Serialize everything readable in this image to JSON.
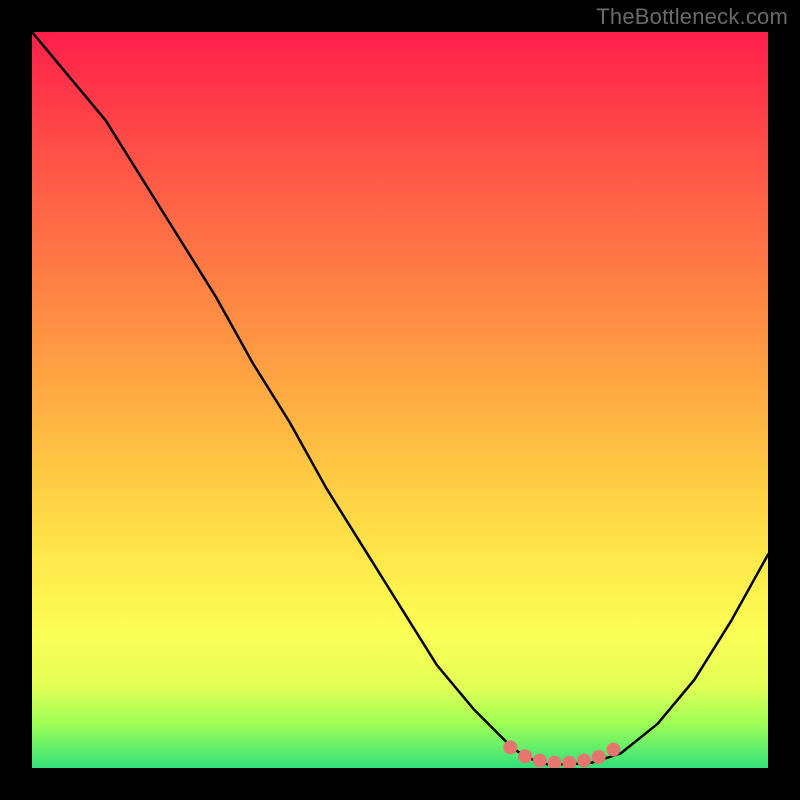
{
  "watermark": "TheBottleneck.com",
  "chart_data": {
    "type": "line",
    "title": "",
    "xlabel": "",
    "ylabel": "",
    "xlim": [
      0,
      100
    ],
    "ylim": [
      0,
      100
    ],
    "series": [
      {
        "name": "curve",
        "x": [
          0,
          5,
          10,
          15,
          20,
          25,
          30,
          35,
          40,
          45,
          50,
          55,
          60,
          65,
          67,
          70,
          73,
          76,
          80,
          85,
          90,
          95,
          100
        ],
        "values": [
          100,
          94,
          88,
          80,
          72,
          64,
          55,
          47,
          38,
          30,
          22,
          14,
          8,
          3,
          1.5,
          0.5,
          0.5,
          0.7,
          2,
          6,
          12,
          20,
          29
        ]
      },
      {
        "name": "markers",
        "x": [
          65,
          67,
          69,
          71,
          73,
          75,
          77,
          79
        ],
        "values": [
          2.8,
          1.6,
          1.0,
          0.7,
          0.7,
          1.0,
          1.5,
          2.5
        ]
      }
    ],
    "marker_color": "#e5756f",
    "line_color": "#000000"
  }
}
